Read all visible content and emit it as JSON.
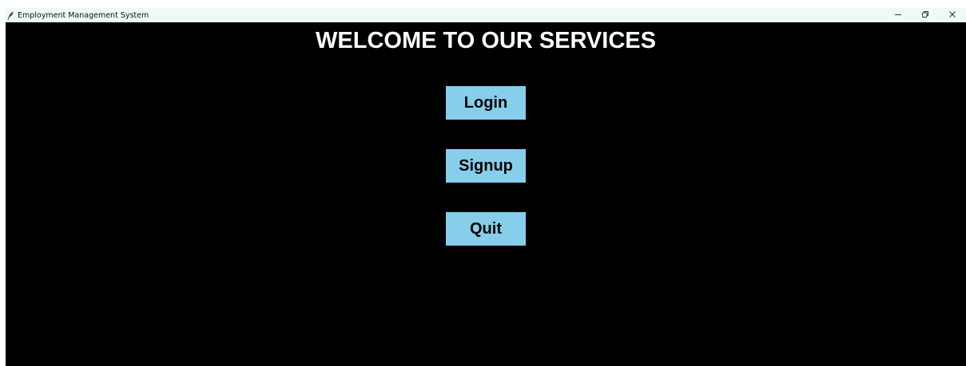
{
  "window": {
    "title": "Employment Management System",
    "icon": "feather-icon",
    "controls": [
      "minimize-icon",
      "restore-icon",
      "close-icon"
    ]
  },
  "main": {
    "heading": "WELCOME TO OUR SERVICES",
    "buttons": [
      {
        "label": "Login"
      },
      {
        "label": "Signup"
      },
      {
        "label": "Quit"
      }
    ]
  },
  "colors": {
    "background": "#000000",
    "titlebar": "#eefbf5",
    "button": "#87ceeb",
    "heading_text": "#ffffff",
    "button_text": "#000000"
  }
}
